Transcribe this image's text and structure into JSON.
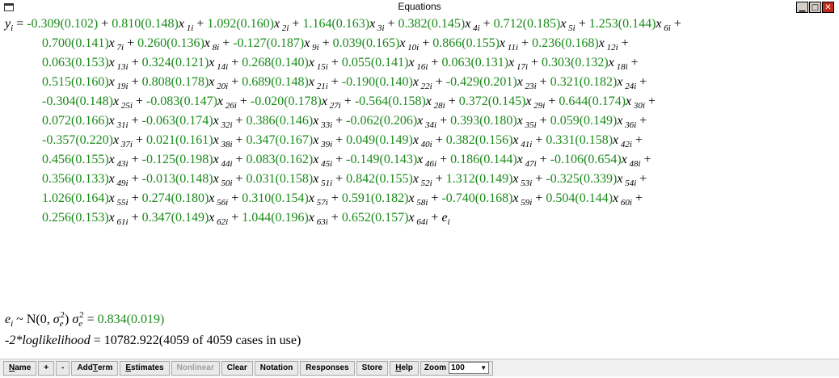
{
  "window": {
    "title": "Equations"
  },
  "equation": {
    "line1": "y_i = -0.309(0.102) + 0.810(0.148)x_1i + 1.092(0.160)x_2i + 1.164(0.163)x_3i + 0.382(0.145)x_4i + 0.712(0.185)x_5i + 1.253(0.144)x_6i +",
    "terms": [
      {
        "coef": "0.810(0.148)",
        "var": "x",
        "sub": "1i"
      },
      {
        "coef": "1.092(0.160)",
        "var": "x",
        "sub": "2i"
      },
      {
        "coef": "1.164(0.163)",
        "var": "x",
        "sub": "3i"
      },
      {
        "coef": "0.382(0.145)",
        "var": "x",
        "sub": "4i"
      },
      {
        "coef": "0.712(0.185)",
        "var": "x",
        "sub": "5i"
      },
      {
        "coef": "1.253(0.144)",
        "var": "x",
        "sub": "6i"
      },
      {
        "coef": "0.700(0.141)",
        "var": "x",
        "sub": "7i"
      },
      {
        "coef": "0.260(0.136)",
        "var": "x",
        "sub": "8i"
      },
      {
        "coef": "-0.127(0.187)",
        "var": "x",
        "sub": "9i"
      },
      {
        "coef": "0.039(0.165)",
        "var": "x",
        "sub": "10i"
      },
      {
        "coef": "0.866(0.155)",
        "var": "x",
        "sub": "11i"
      },
      {
        "coef": "0.236(0.168)",
        "var": "x",
        "sub": "12i"
      },
      {
        "coef": "0.063(0.153)",
        "var": "x",
        "sub": "13i"
      },
      {
        "coef": "0.324(0.121)",
        "var": "x",
        "sub": "14i"
      },
      {
        "coef": "0.268(0.140)",
        "var": "x",
        "sub": "15i"
      },
      {
        "coef": "0.055(0.141)",
        "var": "x",
        "sub": "16i"
      },
      {
        "coef": "0.063(0.131)",
        "var": "x",
        "sub": "17i"
      },
      {
        "coef": "0.303(0.132)",
        "var": "x",
        "sub": "18i"
      },
      {
        "coef": "0.515(0.160)",
        "var": "x",
        "sub": "19i"
      },
      {
        "coef": "0.808(0.178)",
        "var": "x",
        "sub": "20i"
      },
      {
        "coef": "0.689(0.148)",
        "var": "x",
        "sub": "21i"
      },
      {
        "coef": "-0.190(0.140)",
        "var": "x",
        "sub": "22i"
      },
      {
        "coef": "-0.429(0.201)",
        "var": "x",
        "sub": "23i"
      },
      {
        "coef": "0.321(0.182)",
        "var": "x",
        "sub": "24i"
      },
      {
        "coef": "-0.304(0.148)",
        "var": "x",
        "sub": "25i"
      },
      {
        "coef": "-0.083(0.147)",
        "var": "x",
        "sub": "26i"
      },
      {
        "coef": "-0.020(0.178)",
        "var": "x",
        "sub": "27i"
      },
      {
        "coef": "-0.564(0.158)",
        "var": "x",
        "sub": "28i"
      },
      {
        "coef": "0.372(0.145)",
        "var": "x",
        "sub": "29i"
      },
      {
        "coef": "0.644(0.174)",
        "var": "x",
        "sub": "30i"
      },
      {
        "coef": "0.072(0.166)",
        "var": "x",
        "sub": "31i"
      },
      {
        "coef": "-0.063(0.174)",
        "var": "x",
        "sub": "32i"
      },
      {
        "coef": "0.386(0.146)",
        "var": "x",
        "sub": "33i"
      },
      {
        "coef": "-0.062(0.206)",
        "var": "x",
        "sub": "34i"
      },
      {
        "coef": "0.393(0.180)",
        "var": "x",
        "sub": "35i"
      },
      {
        "coef": "0.059(0.149)",
        "var": "x",
        "sub": "36i"
      },
      {
        "coef": "-0.357(0.220)",
        "var": "x",
        "sub": "37i"
      },
      {
        "coef": "0.021(0.161)",
        "var": "x",
        "sub": "38i"
      },
      {
        "coef": "0.347(0.167)",
        "var": "x",
        "sub": "39i"
      },
      {
        "coef": "0.049(0.149)",
        "var": "x",
        "sub": "40i"
      },
      {
        "coef": "0.382(0.156)",
        "var": "x",
        "sub": "41i"
      },
      {
        "coef": "0.331(0.158)",
        "var": "x",
        "sub": "42i"
      },
      {
        "coef": "0.456(0.155)",
        "var": "x",
        "sub": "43i"
      },
      {
        "coef": "-0.125(0.198)",
        "var": "x",
        "sub": "44i"
      },
      {
        "coef": "0.083(0.162)",
        "var": "x",
        "sub": "45i"
      },
      {
        "coef": "-0.149(0.143)",
        "var": "x",
        "sub": "46i"
      },
      {
        "coef": "0.186(0.144)",
        "var": "x",
        "sub": "47i"
      },
      {
        "coef": "-0.106(0.654)",
        "var": "x",
        "sub": "48i"
      },
      {
        "coef": "0.356(0.133)",
        "var": "x",
        "sub": "49i"
      },
      {
        "coef": "-0.013(0.148)",
        "var": "x",
        "sub": "50i"
      },
      {
        "coef": "0.031(0.158)",
        "var": "x",
        "sub": "51i"
      },
      {
        "coef": "0.842(0.155)",
        "var": "x",
        "sub": "52i"
      },
      {
        "coef": "1.312(0.149)",
        "var": "x",
        "sub": "53i"
      },
      {
        "coef": "-0.325(0.339)",
        "var": "x",
        "sub": "54i"
      },
      {
        "coef": "1.026(0.164)",
        "var": "x",
        "sub": "55i"
      },
      {
        "coef": "0.274(0.180)",
        "var": "x",
        "sub": "56i"
      },
      {
        "coef": "0.310(0.154)",
        "var": "x",
        "sub": "57i"
      },
      {
        "coef": "0.591(0.182)",
        "var": "x",
        "sub": "58i"
      },
      {
        "coef": "-0.740(0.168)",
        "var": "x",
        "sub": "59i"
      },
      {
        "coef": "0.504(0.144)",
        "var": "x",
        "sub": "60i"
      },
      {
        "coef": "0.256(0.153)",
        "var": "x",
        "sub": "61i"
      },
      {
        "coef": "0.347(0.149)",
        "var": "x",
        "sub": "62i"
      },
      {
        "coef": "1.044(0.196)",
        "var": "x",
        "sub": "63i"
      },
      {
        "coef": "0.652(0.157)",
        "var": "x",
        "sub": "64i"
      }
    ],
    "lhs": "y",
    "lhs_sub": "i",
    "intercept": "-0.309(0.102)",
    "error_term": "e",
    "error_sub": "i",
    "terms_per_line": [
      6,
      6,
      6,
      6,
      6,
      6,
      6,
      6,
      6,
      6,
      4
    ]
  },
  "distribution": {
    "var": "e",
    "var_sub": "i",
    "dist": " ~ N(0, ",
    "sigma": "σ",
    "sigma_sub": "e",
    "sigma_sup": "2",
    "close": ")",
    "estimate": "0.834(0.019)"
  },
  "loglik": {
    "label": "-2*loglikelihood",
    "eq": " = ",
    "value": "10782.922(4059 of 4059 cases in use)"
  },
  "toolbar": {
    "buttons": [
      {
        "label": "Name",
        "underline": "N",
        "disabled": false
      },
      {
        "label": "+",
        "underline": "",
        "disabled": false
      },
      {
        "label": "-",
        "underline": "",
        "disabled": false
      },
      {
        "label": "Add Term",
        "underline": "T",
        "disabled": false
      },
      {
        "label": "Estimates",
        "underline": "E",
        "disabled": false
      },
      {
        "label": "Nonlinear",
        "underline": "",
        "disabled": true
      },
      {
        "label": "Clear",
        "underline": "",
        "disabled": false
      },
      {
        "label": "Notation",
        "underline": "",
        "disabled": false
      },
      {
        "label": "Responses",
        "underline": "",
        "disabled": false
      },
      {
        "label": "Store",
        "underline": "",
        "disabled": false
      },
      {
        "label": "Help",
        "underline": "H",
        "disabled": false
      }
    ],
    "zoom_label": "Zoom",
    "zoom_value": "100"
  },
  "colors": {
    "estimate_green": "#1a8a1a",
    "close_button": "#c42b1c"
  }
}
